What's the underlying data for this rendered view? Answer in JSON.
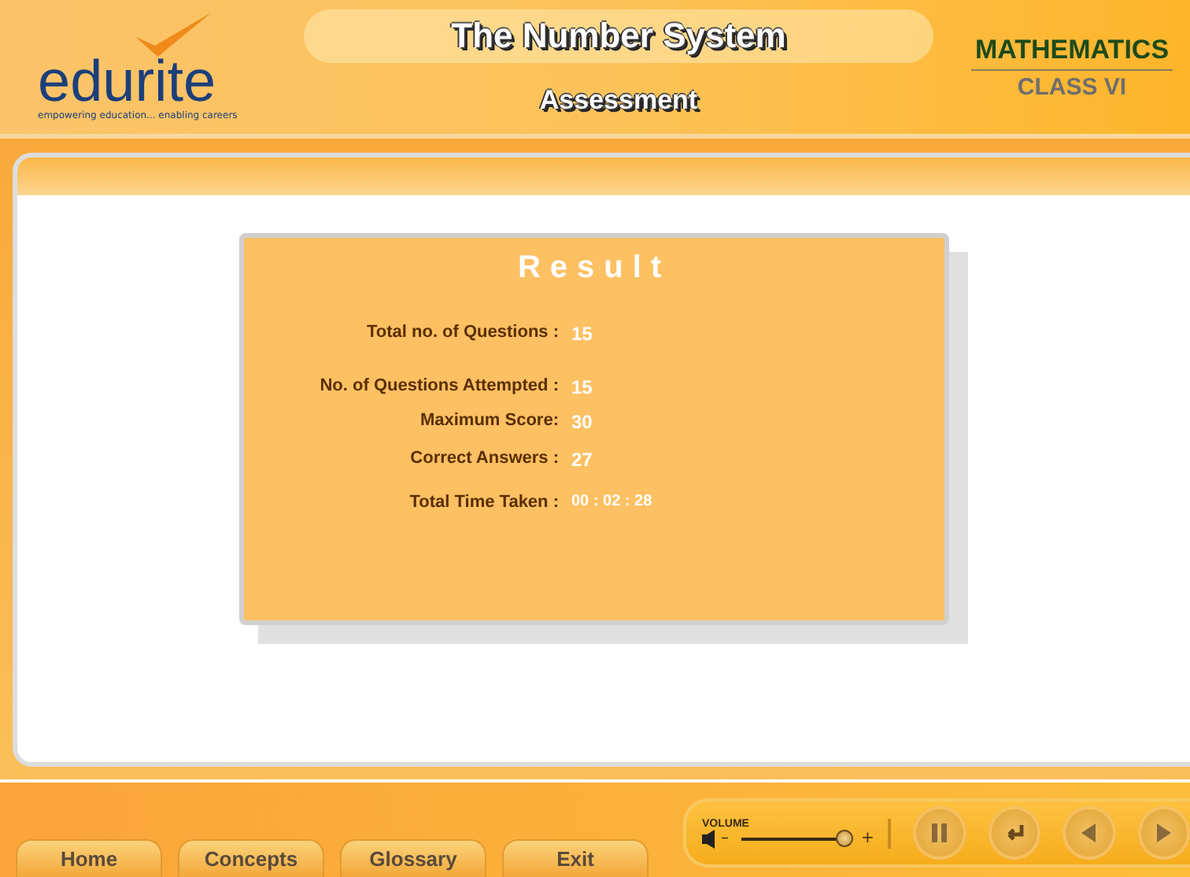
{
  "header": {
    "logo": "edurite",
    "tagline": "empowering education... enabling careers",
    "title": "The Number System",
    "subtitle": "Assessment",
    "subject": "MATHEMATICS",
    "class": "CLASS VI"
  },
  "result": {
    "title": "Result",
    "rows": [
      {
        "label": "Total no. of Questions :",
        "value": "15"
      },
      {
        "label": "No. of Questions Attempted :",
        "value": "15"
      },
      {
        "label": "Maximum Score:",
        "value": "30"
      },
      {
        "label": "Correct Answers :",
        "value": "27"
      },
      {
        "label": "Total Time Taken :",
        "value": "00 : 02 : 28"
      }
    ]
  },
  "footer": {
    "tabs": [
      "Home",
      "Concepts",
      "Glossary",
      "Exit"
    ],
    "volume": {
      "label": "VOLUME",
      "minus": "–",
      "plus": "+",
      "level": 0.95
    },
    "controls": [
      {
        "kind": "pause"
      },
      {
        "kind": "replay"
      },
      {
        "kind": "back"
      },
      {
        "kind": "next"
      }
    ]
  }
}
